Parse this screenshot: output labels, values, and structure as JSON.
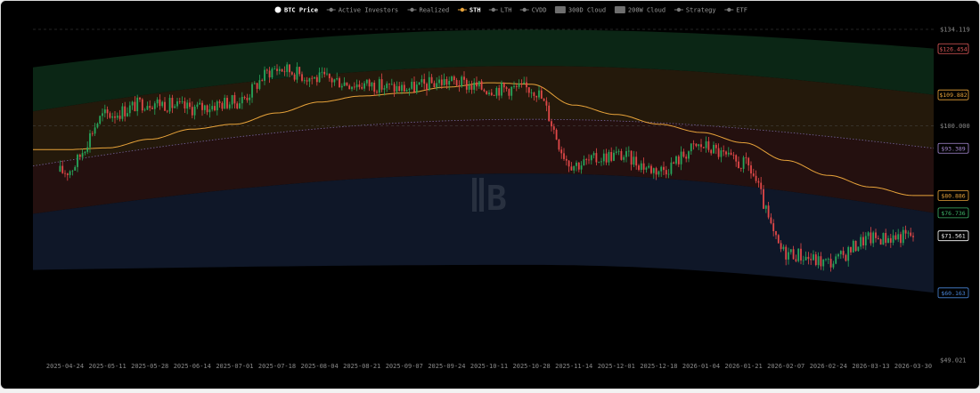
{
  "chart_data": {
    "type": "candlestick",
    "title": "",
    "xlabel": "",
    "ylabel": "",
    "y_scale": "log",
    "ylim": [
      49.021,
      134.119
    ],
    "grid": "horizontal dashed",
    "legend_position": "top-center",
    "legend": [
      {
        "label": "BTC Price",
        "active": true,
        "marker": "dot"
      },
      {
        "label": "Active Investors",
        "active": false,
        "marker": "line"
      },
      {
        "label": "Realized",
        "active": false,
        "marker": "line"
      },
      {
        "label": "STH",
        "active": true,
        "marker": "line"
      },
      {
        "label": "LTH",
        "active": false,
        "marker": "line"
      },
      {
        "label": "CVDD",
        "active": false,
        "marker": "line"
      },
      {
        "label": "300D Cloud",
        "active": false,
        "marker": "box"
      },
      {
        "label": "200W Cloud",
        "active": false,
        "marker": "box"
      },
      {
        "label": "Strategy",
        "active": false,
        "marker": "line"
      },
      {
        "label": "ETF",
        "active": false,
        "marker": "line"
      }
    ],
    "x_ticks": [
      "2025-04-24",
      "2025-05-11",
      "2025-05-28",
      "2025-06-14",
      "2025-07-01",
      "2025-07-18",
      "2025-08-04",
      "2025-08-21",
      "2025-09-07",
      "2025-09-24",
      "2025-10-11",
      "2025-10-28",
      "2025-11-14",
      "2025-12-01",
      "2025-12-18",
      "2026-01-04",
      "2026-01-21",
      "2026-02-07",
      "2026-02-24",
      "2026-03-13",
      "2026-03-30"
    ],
    "y_ticks": [
      {
        "value": 134.119,
        "label": "$134.119"
      },
      {
        "value": 100,
        "label": "$100.000"
      },
      {
        "value": 49.021,
        "label": "$49.021"
      }
    ],
    "price_tags": [
      {
        "value": 126.454,
        "label": "$126.454",
        "color": "#e05a5a"
      },
      {
        "value": 109.882,
        "label": "$109.882",
        "color": "#e8a33a"
      },
      {
        "value": 93.389,
        "label": "$93.389",
        "color": "#a98bd6"
      },
      {
        "value": 80.886,
        "label": "$80.886",
        "color": "#e8a33a"
      },
      {
        "value": 76.736,
        "label": "$76.736",
        "color": "#3fb56a"
      },
      {
        "value": 71.561,
        "label": "$71.561",
        "color": "#ffffff"
      },
      {
        "value": 60.163,
        "label": "$60.163",
        "color": "#4a86d8"
      }
    ],
    "bands": [
      {
        "name": "top",
        "color": "#0b2615",
        "upper_start": 119.5,
        "upper_end": 126.5,
        "upper_peak": 134.0
      },
      {
        "name": "upper-mid",
        "color": "#24190b",
        "upper_start": 104.5,
        "upper_end": 109.9,
        "upper_peak": 120.0
      },
      {
        "name": "mid",
        "color": "#24100f",
        "upper_start": 88.5,
        "upper_end": 93.4,
        "upper_peak": 102.0
      },
      {
        "name": "low",
        "color": "#0f1728",
        "upper_start": 76.5,
        "upper_end": 76.7,
        "upper_peak": 86.5,
        "lower_start": 64.5,
        "lower_end": 60.2,
        "lower_peak": 65.5
      }
    ],
    "series": [
      {
        "name": "STH",
        "kind": "line",
        "color": "#e8a33a",
        "x": [
          "2025-04-24",
          "2025-05-11",
          "2025-05-28",
          "2025-06-14",
          "2025-07-01",
          "2025-07-18",
          "2025-08-04",
          "2025-08-21",
          "2025-09-07",
          "2025-09-24",
          "2025-10-11",
          "2025-10-28",
          "2025-11-14",
          "2025-12-01",
          "2025-12-18",
          "2026-01-04",
          "2026-01-21",
          "2026-02-07",
          "2026-02-24",
          "2026-03-13",
          "2026-03-30"
        ],
        "values": [
          93.0,
          93.5,
          96.0,
          99.0,
          100.5,
          104.0,
          107.5,
          109.5,
          110.5,
          112.5,
          114.0,
          113.5,
          106.5,
          103.5,
          100.5,
          98.0,
          95.0,
          90.0,
          86.0,
          83.0,
          80.886
        ]
      },
      {
        "name": "BTC Price",
        "kind": "candlestick",
        "up_color": "#26a65b",
        "down_color": "#e04848",
        "x": [
          "2025-04-24",
          "2025-05-11",
          "2025-05-28",
          "2025-06-14",
          "2025-07-01",
          "2025-07-18",
          "2025-08-04",
          "2025-08-21",
          "2025-09-07",
          "2025-09-24",
          "2025-10-11",
          "2025-10-28",
          "2025-11-14",
          "2025-12-01",
          "2025-12-18",
          "2026-01-04",
          "2026-01-21",
          "2026-02-07",
          "2026-02-24",
          "2026-03-13",
          "2026-03-30"
        ],
        "values": [
          87.0,
          103.5,
          107.5,
          105.5,
          107.5,
          119.0,
          115.5,
          113.5,
          112.0,
          114.5,
          112.0,
          112.0,
          89.0,
          91.5,
          87.5,
          94.0,
          89.0,
          68.0,
          66.0,
          71.0,
          71.561
        ]
      }
    ]
  }
}
